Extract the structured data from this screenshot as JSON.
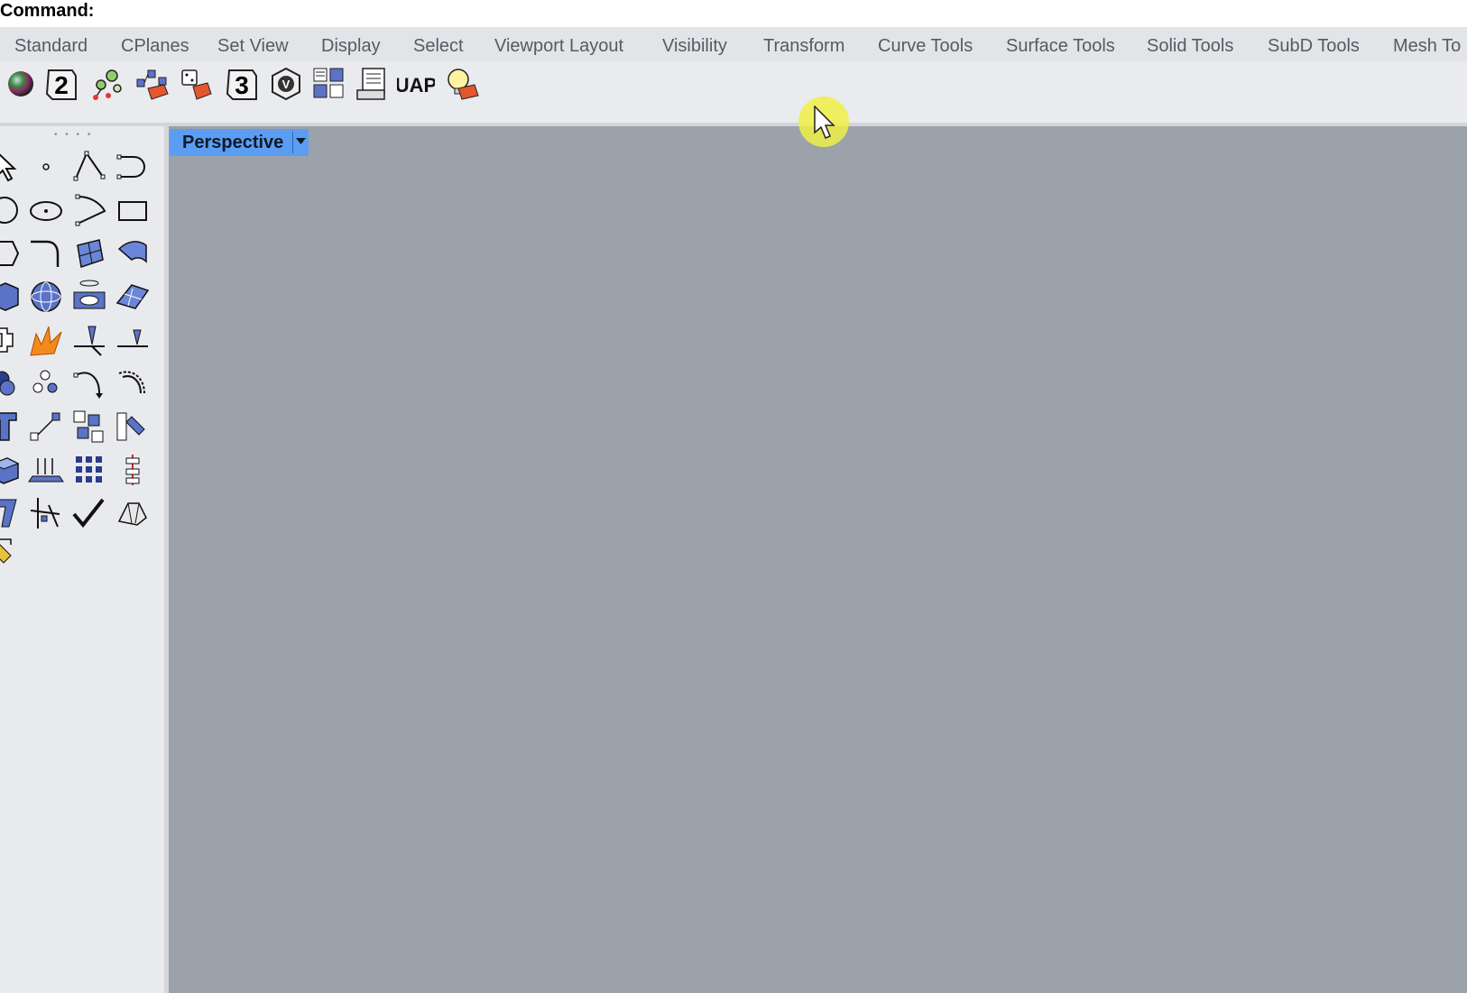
{
  "command": {
    "label": "Command:"
  },
  "tabs": [
    "Standard",
    "CPlanes",
    "Set View",
    "Display",
    "Select",
    "Viewport Layout",
    "Visibility",
    "Transform",
    "Curve Tools",
    "Surface Tools",
    "Solid Tools",
    "SubD Tools",
    "Mesh To"
  ],
  "toolbar": {
    "icons": [
      "sphere-render-icon",
      "two-icon",
      "grasshopper-nodes-icon",
      "network-package-icon",
      "dice-package-icon",
      "three-icon",
      "v-ray-icon",
      "python-layout-icon",
      "document-print-icon",
      "uap-icon",
      "lightbulb-icon"
    ],
    "number2": "2",
    "number3": "3",
    "v_letter": "V",
    "uap_text": "UAP"
  },
  "viewport": {
    "title": "Perspective"
  },
  "left_toolbox": {
    "grip": "• • • •",
    "tools": [
      "select-arrow-icon",
      "point-icon",
      "polyline-icon",
      "curve-icon",
      "circle-icon",
      "ellipse-icon",
      "arc-icon",
      "rectangle-icon",
      "polygon-icon",
      "fillet-curve-icon",
      "surface-patch-icon",
      "loft-surface-icon",
      "box-solid-icon",
      "sphere-solid-icon",
      "cylinder-solid-icon",
      "plane-surface-icon",
      "puzzle-icon",
      "explode-icon",
      "trim-icon",
      "split-icon",
      "group-icon",
      "point-cloud-icon",
      "rotate-icon",
      "scale-icon",
      "text-icon",
      "move-icon",
      "array-icon",
      "mirror-icon",
      "extrude-icon",
      "vector-field-icon",
      "grid-array-icon",
      "dimension-icon",
      "bend-icon",
      "tools-icon",
      "check-icon",
      "mesh-solid-icon",
      "paint-icon"
    ]
  },
  "colors": {
    "viewport_bg": "#9ba2aa",
    "viewport_tab": "#5b9df2",
    "cursor_highlight": "#f0f046"
  }
}
